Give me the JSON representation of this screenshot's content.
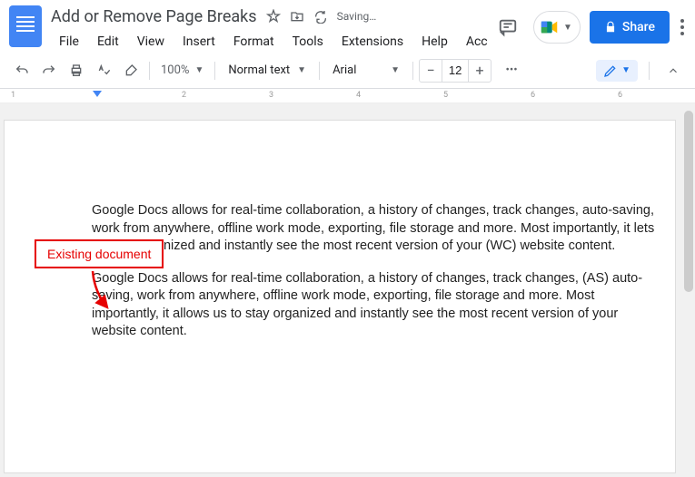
{
  "doc_title": "Add or Remove Page Breaks",
  "saving": "Saving…",
  "menu": {
    "file": "File",
    "edit": "Edit",
    "view": "View",
    "insert": "Insert",
    "format": "Format",
    "tools": "Tools",
    "extensions": "Extensions",
    "help": "Help",
    "acc": "Acc"
  },
  "share_label": "Share",
  "toolbar": {
    "zoom": "100%",
    "style": "Normal text",
    "font": "Arial",
    "font_size": "12",
    "more": "•••"
  },
  "ruler": {
    "n1": "1",
    "n2": "2",
    "n3": "3",
    "n4": "4",
    "n5": "5",
    "n6": "6"
  },
  "annotation": "Existing document",
  "document": {
    "para1": "Google Docs allows for real-time collaboration, a history of changes, track changes, auto-saving, work from anywhere, offline work mode, exporting, file storage and more. Most importantly, it lets us stay organized and instantly see the most recent version of your (WC) website content.",
    "para2": "Google Docs allows for real-time collaboration, a history of changes, track changes, (AS) auto-saving, work from anywhere, offline work mode, exporting, file storage and more. Most importantly, it allows us to stay organized and instantly see the most recent version of your website content."
  }
}
